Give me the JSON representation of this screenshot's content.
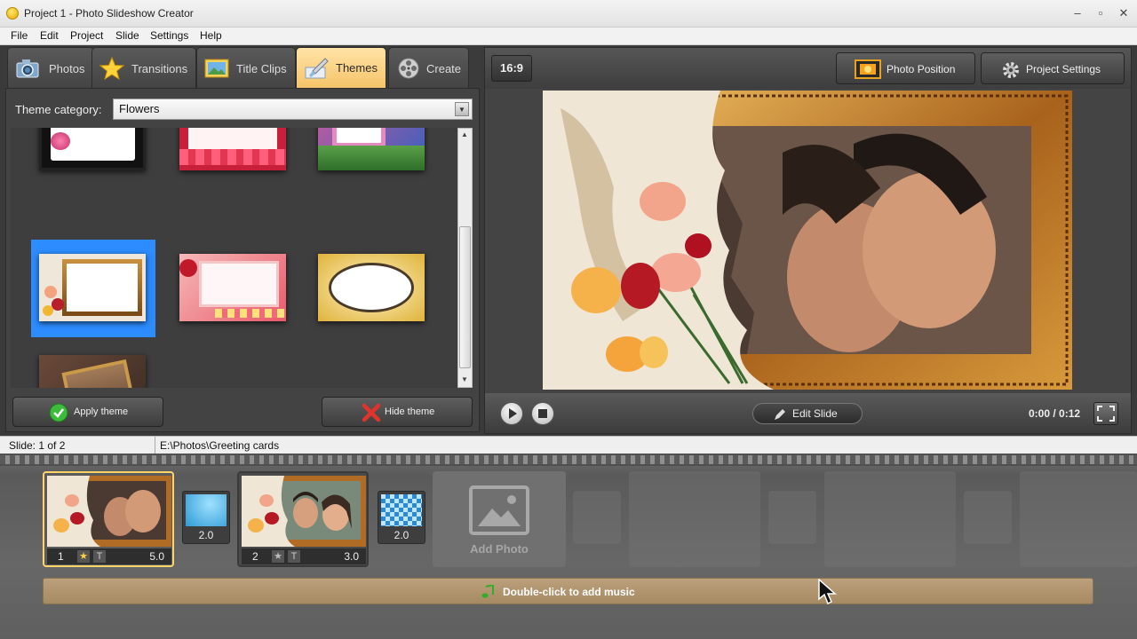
{
  "window": {
    "title": "Project 1 - Photo Slideshow Creator",
    "controls": [
      "–",
      "▫",
      "✕"
    ]
  },
  "menu": [
    "File",
    "Edit",
    "Project",
    "Slide",
    "Settings",
    "Help"
  ],
  "tabs": [
    {
      "label": "Photos",
      "icon": "camera-icon"
    },
    {
      "label": "Transitions",
      "icon": "star-icon"
    },
    {
      "label": "Title Clips",
      "icon": "picture-icon"
    },
    {
      "label": "Themes",
      "icon": "brush-icon",
      "active": true
    },
    {
      "label": "Create",
      "icon": "film-reel-icon"
    }
  ],
  "themes": {
    "category_label": "Theme category:",
    "category_value": "Flowers",
    "apply_label": "Apply theme",
    "hide_label": "Hide theme"
  },
  "preview": {
    "aspect": "16:9",
    "photo_position_label": "Photo Position",
    "project_settings_label": "Project Settings",
    "edit_slide_label": "Edit Slide",
    "time": "0:00 / 0:12"
  },
  "status": {
    "slide": "Slide: 1 of 2",
    "path": "E:\\Photos\\Greeting cards"
  },
  "timeline": {
    "slides": [
      {
        "num": "1",
        "duration": "5.0"
      },
      {
        "num": "2",
        "duration": "3.0"
      }
    ],
    "transitions": [
      "2.0",
      "2.0"
    ],
    "add_photo_label": "Add Photo",
    "music_label": "Double-click to add music"
  },
  "colors": {
    "accent": "#2d8cff",
    "active_tab": "#f5c469",
    "active_slide_border": "#ffd56a"
  }
}
